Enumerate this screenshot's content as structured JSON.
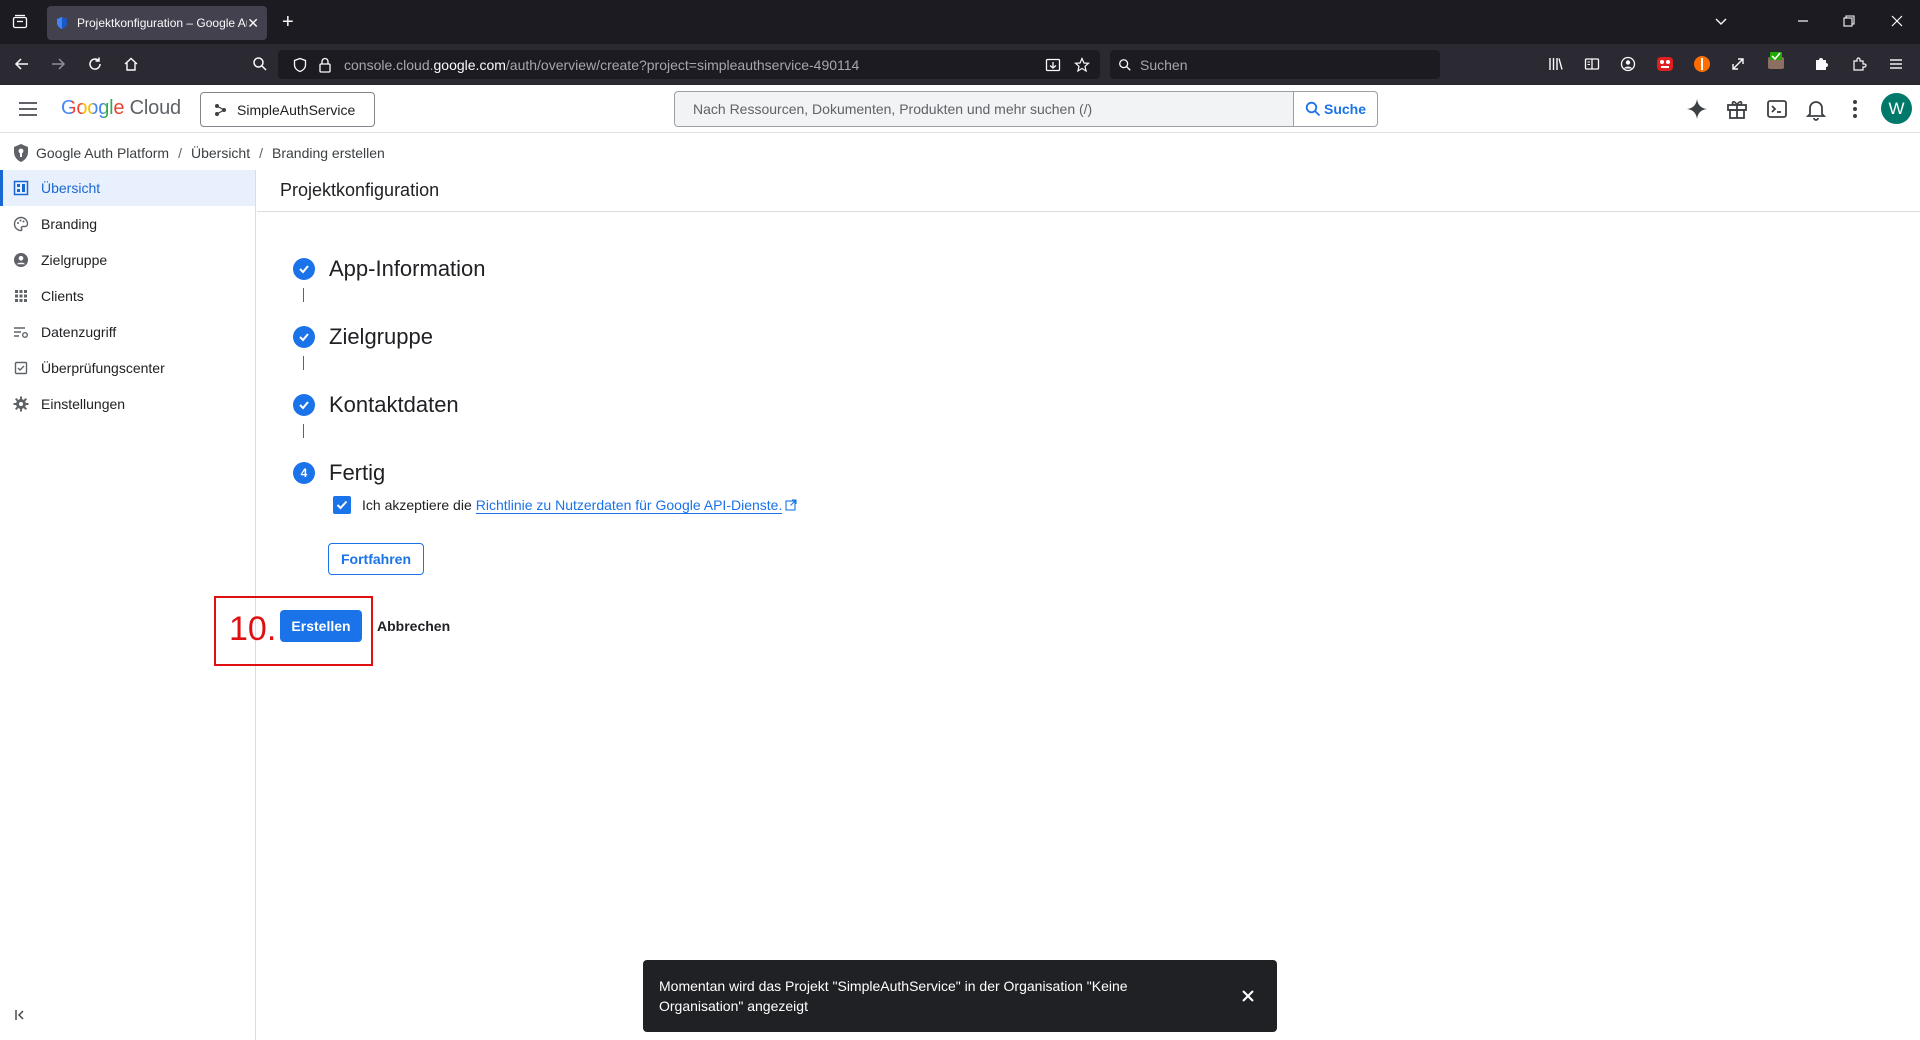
{
  "browser": {
    "tab_title": "Projektkonfiguration – Google Auth Platform",
    "url_prefix": "console.cloud.",
    "url_domain": "google.com",
    "url_path": "/auth/overview/create?project=simpleauthservice-490114",
    "search_placeholder": "Suchen"
  },
  "header": {
    "logo_google": "Google",
    "logo_cloud": "Cloud",
    "project": "SimpleAuthService",
    "search_placeholder": "Nach Ressourcen, Dokumenten, Produkten und mehr suchen (/)",
    "search_button": "Suche",
    "avatar_letter": "W"
  },
  "breadcrumb": {
    "items": [
      "Google Auth Platform",
      "Übersicht",
      "Branding erstellen"
    ]
  },
  "sidebar": {
    "items": [
      {
        "label": "Übersicht",
        "icon": "dashboard-icon",
        "active": true
      },
      {
        "label": "Branding",
        "icon": "palette-icon",
        "active": false
      },
      {
        "label": "Zielgruppe",
        "icon": "account-circle-icon",
        "active": false
      },
      {
        "label": "Clients",
        "icon": "apps-grid-icon",
        "active": false
      },
      {
        "label": "Datenzugriff",
        "icon": "data-access-icon",
        "active": false
      },
      {
        "label": "Überprüfungscenter",
        "icon": "verification-icon",
        "active": false
      },
      {
        "label": "Einstellungen",
        "icon": "gear-icon",
        "active": false
      }
    ]
  },
  "main": {
    "page_title": "Projektkonfiguration",
    "steps": [
      {
        "label": "App-Information",
        "status": "done"
      },
      {
        "label": "Zielgruppe",
        "status": "done"
      },
      {
        "label": "Kontaktdaten",
        "status": "done"
      },
      {
        "label": "Fertig",
        "status": "current",
        "number": "4"
      }
    ],
    "consent_prefix": "Ich akzeptiere die",
    "consent_link": "Richtlinie zu Nutzerdaten für Google API-Dienste.",
    "consent_checked": true,
    "continue_button": "Fortfahren",
    "annotation": "10.",
    "create_button": "Erstellen",
    "cancel_button": "Abbrechen"
  },
  "snackbar": {
    "message": "Momentan wird das Projekt \"SimpleAuthService\" in der Organisation \"Keine Organisation\" angezeigt"
  },
  "colors": {
    "accent": "#1a73e8",
    "annotation": "#e01010",
    "browser_dark": "#1c1b22"
  }
}
